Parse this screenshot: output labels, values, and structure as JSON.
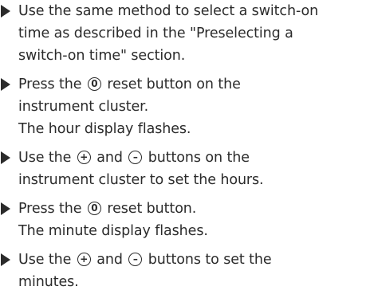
{
  "steps": [
    {
      "lines": [
        "Use the same method to select a switch-on",
        "time as described in the \"Preselecting a",
        "switch-on time\" section."
      ]
    },
    {
      "line1_pre": "Press the",
      "line1_post": "reset button on the",
      "line2": "instrument cluster.",
      "result": "The hour display flashes."
    },
    {
      "line1_a": "Use the",
      "line1_b": "and",
      "line1_c": "buttons on the",
      "line2": "instrument cluster to set the hours."
    },
    {
      "line1_pre": "Press the",
      "line1_post": "reset button.",
      "result": "The minute display flashes."
    },
    {
      "line1_a": "Use the",
      "line1_b": "and",
      "line1_c": "buttons to set the",
      "line2": "minutes."
    }
  ],
  "icons": {
    "reset": "0",
    "plus": "+",
    "minus": "–"
  }
}
